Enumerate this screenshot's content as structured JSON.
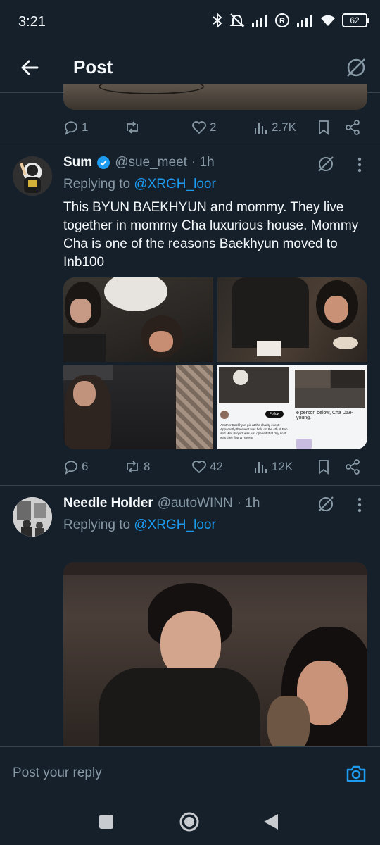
{
  "status_bar": {
    "time": "3:21",
    "battery": "62"
  },
  "header": {
    "title": "Post"
  },
  "prev_tweet": {
    "replies": "1",
    "retweets": "",
    "likes": "2",
    "views": "2.7K"
  },
  "tweet1": {
    "name": "Sum",
    "handle": "@sue_meet",
    "time": "· 1h",
    "replying_prefix": "Replying to ",
    "replying_to": "@XRGH_loor",
    "text": "This BYUN BAEKHYUN and mommy. They live together in mommy Cha luxurious house. Mommy Cha is one of the reasons Baekhyun moved to Inb100",
    "replies": "6",
    "retweets": "8",
    "likes": "42",
    "views": "12K",
    "media4": {
      "caption_right": "e person below, Cha Dae-young.",
      "follow": "Follow",
      "tweet_text": "Another Baekhyun pic at the charity event! Apparently the event was held on the 4th of Feb and Mint Project was just opened that day so it was their first art event!"
    }
  },
  "tweet2": {
    "name": "Needle Holder",
    "handle": "@autoWINN",
    "time": "· 1h",
    "replying_prefix": "Replying to ",
    "replying_to": "@XRGH_loor"
  },
  "compose": {
    "placeholder": "Post your reply"
  },
  "colors": {
    "bg": "#15202b",
    "accent": "#1d9bf0",
    "muted": "#8899a6",
    "border": "#38444d"
  }
}
